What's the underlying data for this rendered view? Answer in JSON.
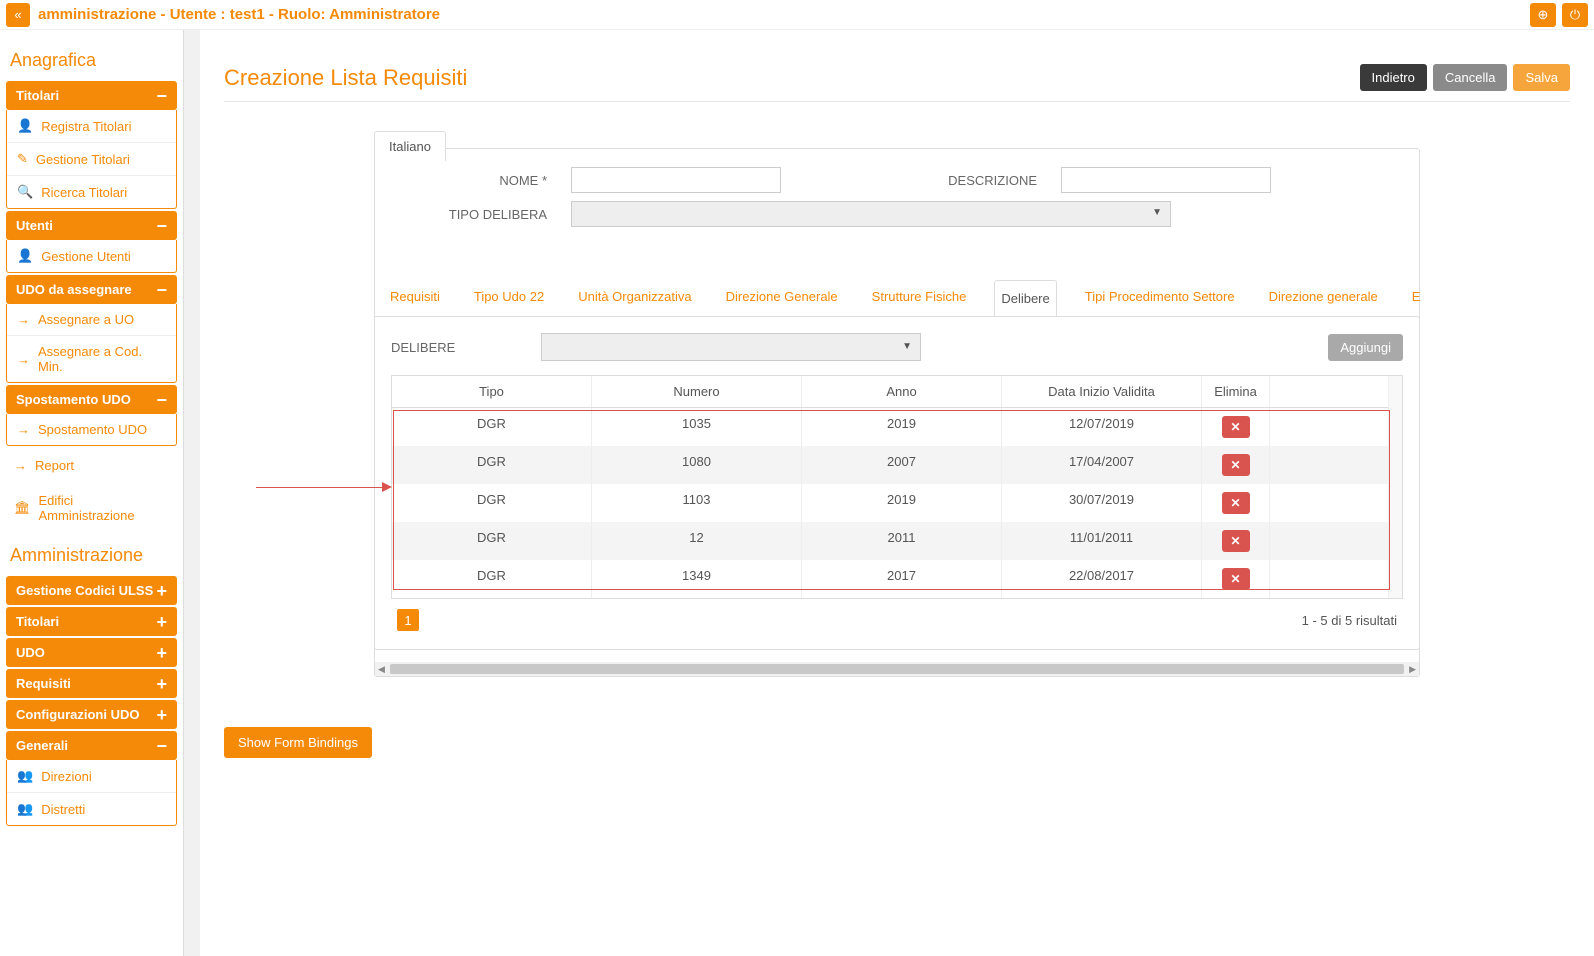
{
  "header": {
    "title": "amministrazione - Utente : test1 - Ruolo: Amministratore"
  },
  "sidebar": {
    "section1_title": "Anagrafica",
    "section2_title": "Amministrazione",
    "groups": {
      "titolari": {
        "label": "Titolari",
        "items": [
          "Registra Titolari",
          "Gestione Titolari",
          "Ricerca Titolari"
        ]
      },
      "utenti": {
        "label": "Utenti",
        "items": [
          "Gestione Utenti"
        ]
      },
      "udo_ass": {
        "label": "UDO da assegnare",
        "items": [
          "Assegnare a UO",
          "Assegnare a Cod. Min."
        ]
      },
      "spost": {
        "label": "Spostamento UDO",
        "items": [
          "Spostamento UDO"
        ]
      },
      "report": "Report",
      "edifici": "Edifici Amministrazione",
      "codici": {
        "label": "Gestione Codici ULSS"
      },
      "titolari2": {
        "label": "Titolari"
      },
      "udo": {
        "label": "UDO"
      },
      "requisiti": {
        "label": "Requisiti"
      },
      "conf_udo": {
        "label": "Configurazioni UDO"
      },
      "generali": {
        "label": "Generali",
        "items": [
          "Direzioni",
          "Distretti"
        ]
      }
    }
  },
  "main": {
    "title": "Creazione Lista Requisiti",
    "buttons": {
      "back": "Indietro",
      "cancel": "Cancella",
      "save": "Salva"
    },
    "lang_tab": "Italiano",
    "form": {
      "name_label": "NOME *",
      "desc_label": "DESCRIZIONE",
      "tipo_label": "TIPO DELIBERA"
    },
    "tabs": [
      "Requisiti",
      "Tipo Udo 22",
      "Unità Organizzativa",
      "Direzione Generale",
      "Strutture Fisiche",
      "Delibere",
      "Tipi Procedimento Settore",
      "Direzione generale",
      "Edifi"
    ],
    "active_tab_index": 5,
    "delibere": {
      "label": "DELIBERE",
      "add": "Aggiungi",
      "columns": {
        "tipo": "Tipo",
        "numero": "Numero",
        "anno": "Anno",
        "data": "Data Inizio Validita",
        "elimina": "Elimina"
      },
      "rows": [
        {
          "tipo": "DGR",
          "numero": "1035",
          "anno": "2019",
          "data": "12/07/2019"
        },
        {
          "tipo": "DGR",
          "numero": "1080",
          "anno": "2007",
          "data": "17/04/2007"
        },
        {
          "tipo": "DGR",
          "numero": "1103",
          "anno": "2019",
          "data": "30/07/2019"
        },
        {
          "tipo": "DGR",
          "numero": "12",
          "anno": "2011",
          "data": "11/01/2011"
        },
        {
          "tipo": "DGR",
          "numero": "1349",
          "anno": "2017",
          "data": "22/08/2017"
        }
      ],
      "page": "1",
      "results": "1 - 5 di 5 risultati"
    },
    "show_bindings": "Show Form Bindings"
  }
}
